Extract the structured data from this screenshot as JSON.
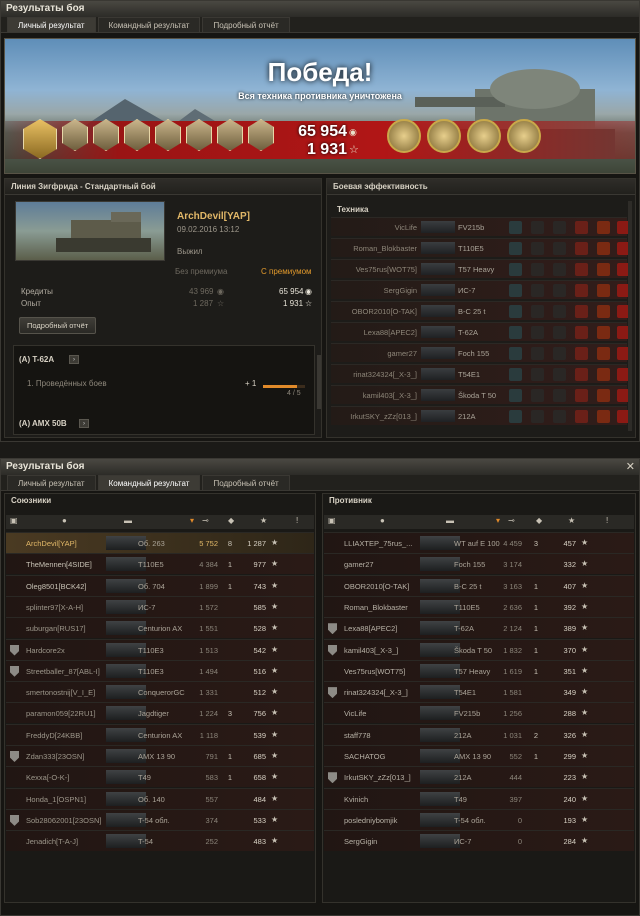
{
  "window1": {
    "title": "Результаты боя",
    "tabs": [
      "Личный результат",
      "Командный результат",
      "Подробный отчёт"
    ],
    "active_tab": 0
  },
  "banner": {
    "title": "Победа!",
    "subtitle": "Вся техника противника уничтожена",
    "credits": "65 954",
    "experience": "1 931"
  },
  "battle": {
    "header": "Линия Зигфрида - Стандартный бой",
    "player": "ArchDevil[YAP]",
    "date": "09.02.2016 13:12",
    "status": "Выжил",
    "col_no_prem": "Без премиума",
    "col_prem": "С премиумом",
    "rows": [
      {
        "label": "Кредиты",
        "no_prem": "43 969",
        "prem": "65 954"
      },
      {
        "label": "Опыт",
        "no_prem": "1 287",
        "prem": "1 931"
      }
    ],
    "details_button": "Подробный отчёт"
  },
  "quests": [
    {
      "name": "(A) T-62A",
      "task": "1. Проведённых боев",
      "progress_delta": "+ 1",
      "progress_text": "4 / 5",
      "progress": 0.8
    },
    {
      "name": "(A) AMX 50B"
    }
  ],
  "efficiency": {
    "header": "Боевая эффективность",
    "section": "Техника",
    "rows": [
      {
        "name": "VicLife",
        "tank": "FV215b"
      },
      {
        "name": "Roman_Blokbaster",
        "tank": "T110E5"
      },
      {
        "name": "Ves75rus[WOT75]",
        "tank": "T57 Heavy"
      },
      {
        "name": "SergGigin",
        "tank": "ИС-7"
      },
      {
        "name": "OBOR2010[O-TAK]",
        "tank": "B-C 25 t"
      },
      {
        "name": "Lexa88[APEC2]",
        "tank": "T-62A"
      },
      {
        "name": "gamer27",
        "tank": "Foch 155"
      },
      {
        "name": "rinat324324[_X-3_]",
        "tank": "T54E1"
      },
      {
        "name": "kamil403[_X-3_]",
        "tank": "Škoda T 50"
      },
      {
        "name": "IrkutSKY_zZz[013_]",
        "tank": "212A"
      }
    ]
  },
  "window2": {
    "title": "Результаты боя",
    "tabs": [
      "Личный результат",
      "Командный результат",
      "Подробный отчёт"
    ],
    "active_tab": 1
  },
  "allies": {
    "header": "Союзники",
    "rows": [
      {
        "name": "ArchDevil[YAP]",
        "tank": "Об. 263",
        "dmg": "5 752",
        "kills": "8",
        "xp": "1 287"
      },
      {
        "name": "TheMennen[4SIDE]",
        "tank": "T110E5",
        "dmg": "4 384",
        "kills": "1",
        "xp": "977"
      },
      {
        "name": "Oleg8501[BCK42]",
        "tank": "Об. 704",
        "dmg": "1 899",
        "kills": "1",
        "xp": "743"
      },
      {
        "name": "splinter97[X-A-H]",
        "tank": "ИС-7",
        "dmg": "1 572",
        "kills": "",
        "xp": "585"
      },
      {
        "name": "suburgan[RUS17]",
        "tank": "Centurion AX",
        "dmg": "1 551",
        "kills": "",
        "xp": "528"
      },
      {
        "name": "Hardcore2x",
        "tank": "T110E3",
        "dmg": "1 513",
        "kills": "",
        "xp": "542"
      },
      {
        "name": "Streetballer_87[ABL-I]",
        "tank": "T110E3",
        "dmg": "1 494",
        "kills": "",
        "xp": "516"
      },
      {
        "name": "smertonostnij[V_I_E]",
        "tank": "ConquerorGC",
        "dmg": "1 331",
        "kills": "",
        "xp": "512"
      },
      {
        "name": "paramon059[22RU1]",
        "tank": "Jagdtiger",
        "dmg": "1 224",
        "kills": "3",
        "xp": "756"
      },
      {
        "name": "FreddyD[24KBB]",
        "tank": "Centurion AX",
        "dmg": "1 118",
        "kills": "",
        "xp": "539"
      },
      {
        "name": "Zdan333[23OSN]",
        "tank": "AMX 13 90",
        "dmg": "791",
        "kills": "1",
        "xp": "685"
      },
      {
        "name": "Kexxa[-O-K-]",
        "tank": "T49",
        "dmg": "583",
        "kills": "1",
        "xp": "658"
      },
      {
        "name": "Honda_1[OSPN1]",
        "tank": "Об. 140",
        "dmg": "557",
        "kills": "",
        "xp": "484"
      },
      {
        "name": "Sob28062001[23OSN]",
        "tank": "T-54 обл.",
        "dmg": "374",
        "kills": "",
        "xp": "533"
      },
      {
        "name": "Jenadich[T-A-J]",
        "tank": "T-54",
        "dmg": "252",
        "kills": "",
        "xp": "483"
      }
    ]
  },
  "enemies": {
    "header": "Противник",
    "rows": [
      {
        "name": "LLIAXTEP_75rus_...",
        "tank": "WT auf E 100",
        "dmg": "4 459",
        "kills": "3",
        "xp": "457"
      },
      {
        "name": "gamer27",
        "tank": "Foch 155",
        "dmg": "3 174",
        "kills": "",
        "xp": "332"
      },
      {
        "name": "OBOR2010[O-TAK]",
        "tank": "B-C 25 t",
        "dmg": "3 163",
        "kills": "1",
        "xp": "407"
      },
      {
        "name": "Roman_Blokbaster",
        "tank": "T110E5",
        "dmg": "2 636",
        "kills": "1",
        "xp": "392"
      },
      {
        "name": "Lexa88[APEC2]",
        "tank": "T-62A",
        "dmg": "2 124",
        "kills": "1",
        "xp": "389"
      },
      {
        "name": "kamil403[_X-3_]",
        "tank": "Škoda T 50",
        "dmg": "1 832",
        "kills": "1",
        "xp": "370"
      },
      {
        "name": "Ves75rus[WOT75]",
        "tank": "T57 Heavy",
        "dmg": "1 619",
        "kills": "1",
        "xp": "351"
      },
      {
        "name": "rinat324324[_X-3_]",
        "tank": "T54E1",
        "dmg": "1 581",
        "kills": "",
        "xp": "349"
      },
      {
        "name": "VicLife",
        "tank": "FV215b",
        "dmg": "1 256",
        "kills": "",
        "xp": "288"
      },
      {
        "name": "staff778",
        "tank": "212A",
        "dmg": "1 031",
        "kills": "2",
        "xp": "326"
      },
      {
        "name": "SACHATOG",
        "tank": "AMX 13 90",
        "dmg": "552",
        "kills": "1",
        "xp": "299"
      },
      {
        "name": "IrkutSKY_zZz[013_]",
        "tank": "212A",
        "dmg": "444",
        "kills": "",
        "xp": "223"
      },
      {
        "name": "Kvinich",
        "tank": "T49",
        "dmg": "397",
        "kills": "",
        "xp": "240"
      },
      {
        "name": "posledniybomjik",
        "tank": "T-54 обл.",
        "dmg": "0",
        "kills": "",
        "xp": "193"
      },
      {
        "name": "SergGigin",
        "tank": "ИС-7",
        "dmg": "0",
        "kills": "",
        "xp": "284"
      }
    ]
  },
  "colors": {
    "gold": "#e2b868",
    "victory_red": "#b11616",
    "orange": "#e08a2a"
  }
}
